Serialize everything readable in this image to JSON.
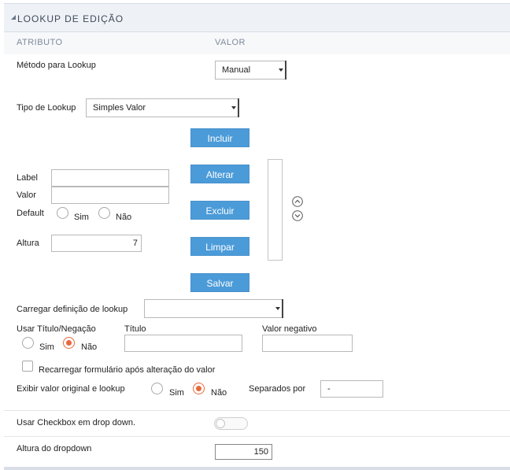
{
  "header": {
    "title": "LOOKUP DE EDIÇÃO"
  },
  "columns": {
    "attribute": "ATRIBUTO",
    "value": "VALOR"
  },
  "lookup_method": {
    "label": "Método para Lookup",
    "value": "Manual"
  },
  "lookup_type": {
    "label": "Tipo de Lookup",
    "value": "Simples Valor"
  },
  "buttons": {
    "incluir": "Incluir",
    "alterar": "Alterar",
    "excluir": "Excluir",
    "limpar": "Limpar",
    "salvar": "Salvar"
  },
  "fields": {
    "label": "Label",
    "label_value": "",
    "valor": "Valor",
    "valor_value": "",
    "default": "Default",
    "sim": "Sim",
    "nao": "Não",
    "altura": "Altura",
    "altura_value": "7"
  },
  "load_definition": {
    "label": "Carregar definição de lookup",
    "value": ""
  },
  "title_negation": {
    "label": "Usar Título/Negação",
    "sim": "Sim",
    "nao": "Não",
    "selected": "Não",
    "titulo_label": "Título",
    "titulo_value": "",
    "valor_negativo_label": "Valor negativo",
    "valor_negativo_value": ""
  },
  "reload_form": {
    "label": "Recarregar formulário após alteração do valor",
    "checked": false
  },
  "show_original": {
    "label": "Exibir valor original e lookup",
    "sim": "Sim",
    "nao": "Não",
    "selected": "Não",
    "separator_label": "Separados por",
    "separator_value": "-"
  },
  "checkbox_dropdown": {
    "label": "Usar Checkbox em drop down.",
    "enabled": false
  },
  "dropdown_height": {
    "label": "Altura do dropdown",
    "value": "150"
  },
  "colors": {
    "button": "#4b9bd8",
    "radio_selected": "#e8683a",
    "header_bg": "#eef1f6"
  }
}
